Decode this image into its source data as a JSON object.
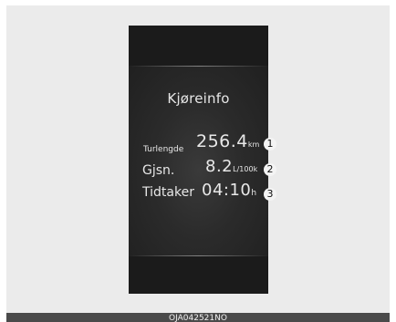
{
  "display": {
    "title": "Kjøreinfo",
    "rows": [
      {
        "label": "Turlengde",
        "value": "256.4",
        "unit": "km",
        "callout": "1"
      },
      {
        "label": "Gjsn.",
        "value": "8.2",
        "unit": "L/100k",
        "callout": "2"
      },
      {
        "label": "Tidtaker",
        "value": "04:10",
        "unit": "h",
        "callout": "3"
      }
    ]
  },
  "caption": "OJA042521NO",
  "colors": {
    "background": "#ebebeb",
    "display": "#1e1e1e",
    "text": "#e8e8e8",
    "caption_bar": "#4a4a4a"
  }
}
